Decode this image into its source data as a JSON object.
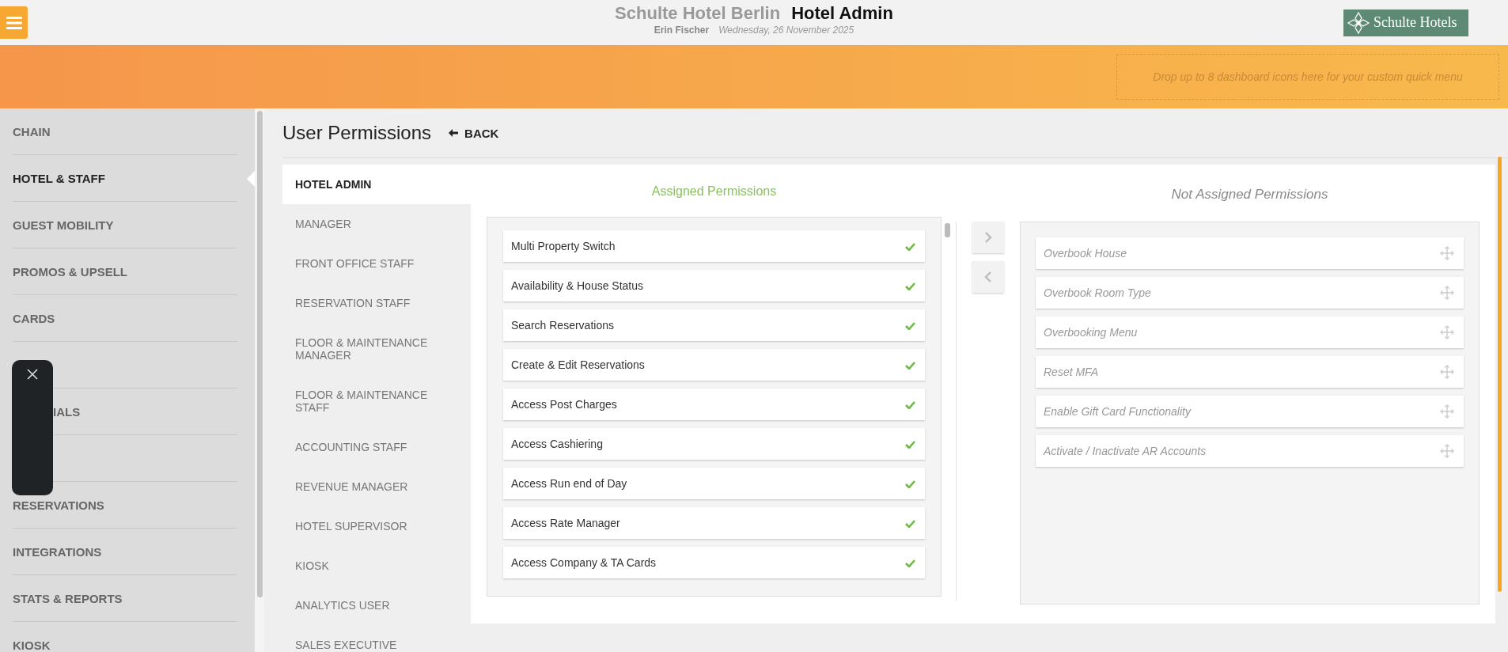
{
  "header": {
    "hotel": "Schulte Hotel Berlin",
    "app": "Hotel Admin",
    "user": "Erin Fischer",
    "date": "Wednesday, 26 November 2025",
    "logo": "Schulte Hotels"
  },
  "quick_menu": {
    "placeholder": "Drop up to 8 dashboard icons here for your custom quick menu"
  },
  "sidebar": {
    "items": [
      {
        "kind": "item",
        "label": "CHAIN",
        "selected": false
      },
      {
        "kind": "item",
        "label": "HOTEL & STAFF",
        "selected": true
      },
      {
        "kind": "item",
        "label": "GUEST MOBILITY",
        "selected": false
      },
      {
        "kind": "item",
        "label": "PROMOS & UPSELL",
        "selected": false
      },
      {
        "kind": "item",
        "label": "CARDS",
        "selected": false
      },
      {
        "kind": "blank"
      },
      {
        "kind": "partial",
        "label": "IALS",
        "selected": false
      },
      {
        "kind": "blank"
      },
      {
        "kind": "item",
        "label": "RESERVATIONS",
        "selected": false
      },
      {
        "kind": "item",
        "label": "INTEGRATIONS",
        "selected": false
      },
      {
        "kind": "item",
        "label": "STATS & REPORTS",
        "selected": false
      },
      {
        "kind": "item",
        "label": "KIOSK",
        "selected": false
      }
    ]
  },
  "page": {
    "title": "User Permissions",
    "back": "BACK"
  },
  "roles": [
    {
      "label": "HOTEL ADMIN",
      "selected": true
    },
    {
      "label": "MANAGER",
      "selected": false
    },
    {
      "label": "FRONT OFFICE STAFF",
      "selected": false
    },
    {
      "label": "RESERVATION STAFF",
      "selected": false
    },
    {
      "label": "FLOOR & MAINTENANCE MANAGER",
      "selected": false
    },
    {
      "label": "FLOOR & MAINTENANCE STAFF",
      "selected": false
    },
    {
      "label": "ACCOUNTING STAFF",
      "selected": false
    },
    {
      "label": "REVENUE MANAGER",
      "selected": false
    },
    {
      "label": "HOTEL SUPERVISOR",
      "selected": false
    },
    {
      "label": "KIOSK",
      "selected": false
    },
    {
      "label": "ANALYTICS USER",
      "selected": false
    },
    {
      "label": "SALES EXECUTIVE",
      "selected": false
    }
  ],
  "assigned": {
    "title": "Assigned Permissions",
    "items": [
      "Multi Property Switch",
      "Availability & House Status",
      "Search Reservations",
      "Create & Edit Reservations",
      "Access Post Charges",
      "Access Cashiering",
      "Access Run end of Day",
      "Access Rate Manager",
      "Access Company & TA Cards"
    ]
  },
  "not_assigned": {
    "title": "Not Assigned Permissions",
    "items": [
      "Overbook House",
      "Overbook Room Type",
      "Overbooking Menu",
      "Reset MFA",
      "Enable Gift Card Functionality",
      "Activate / Inactivate AR Accounts"
    ]
  }
}
